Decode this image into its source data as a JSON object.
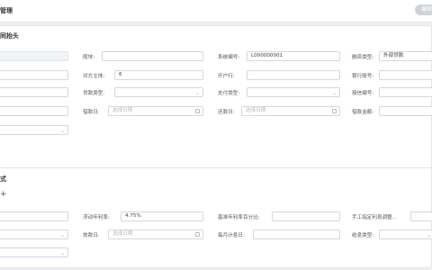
{
  "header": {
    "title": "管理",
    "edit_label": "编辑"
  },
  "section1": {
    "title": "同抬头",
    "fields": {
      "col2_row1": {
        "label": "般块:",
        "value": ""
      },
      "system_no": {
        "label": "系统编号:",
        "value": "L000000001"
      },
      "financing_type": {
        "label": "融资类型:",
        "value": "外部贷款"
      },
      "counterparty": {
        "label": "对方主体:",
        "value": "6"
      },
      "account_holder": {
        "label": "开户行:",
        "value": ""
      },
      "bank_account": {
        "label": "银行账号:",
        "value": ""
      },
      "loan_type": {
        "label": "贷款类型:",
        "value": ""
      },
      "pay_type": {
        "label": "支付类型:",
        "value": ""
      },
      "credit_no": {
        "label": "授信编号:",
        "value": ""
      },
      "borrow_date": {
        "label": "借款日:",
        "placeholder": "选择日期"
      },
      "repay_date": {
        "label": "还款日:",
        "placeholder": "选择日期"
      },
      "loan_amount": {
        "label": "借款金额:",
        "value": ""
      }
    }
  },
  "section2": {
    "title": "式",
    "add_label": "+",
    "fields": {
      "float_rate": {
        "label": "浮动年利率:",
        "value": "4.75%"
      },
      "base_rate_pct": {
        "label": "基准年利率百分比:",
        "value": ""
      },
      "manual_adjust": {
        "label": "手工指定利息调整...",
        "value": ""
      },
      "release_date": {
        "label": "放款日:",
        "placeholder": "选择日期"
      },
      "monthly_day": {
        "label": "每月计息日:",
        "value": ""
      },
      "interest_type": {
        "label": "结息类型:",
        "value": ""
      }
    }
  }
}
